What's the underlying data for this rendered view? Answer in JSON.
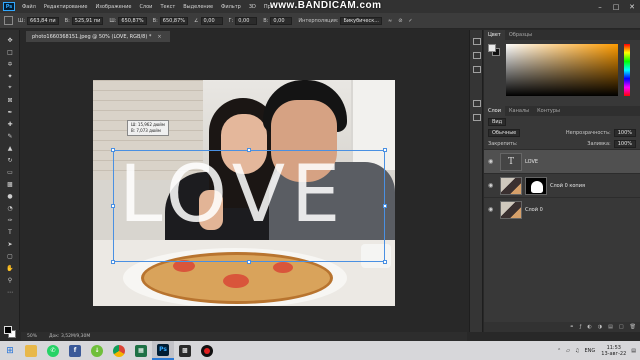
{
  "menubar": {
    "logo": "Ps",
    "items": [
      "Файл",
      "Редактирование",
      "Изображение",
      "Слои",
      "Текст",
      "Выделение",
      "Фильтр",
      "3D",
      "Пр"
    ],
    "watermark": "www.BANDICAM.com"
  },
  "options": {
    "w_label": "Ш:",
    "w_value": "663,84 пи",
    "h_label": "В:",
    "h_value": "525,91 пи",
    "sw_label": "Ш:",
    "sw_value": "650,87%",
    "sh_label": "В:",
    "sh_value": "650,87%",
    "angle_value": "0,00",
    "hskew_label": "Г:",
    "hskew_value": "0,00",
    "vskew_label": "В:",
    "vskew_value": "0,00",
    "interp_label": "Интерполяция:",
    "interp_value": "Бикубическ..."
  },
  "document": {
    "tab_title": "photo1660368151.jpeg @ 50% (LOVE, RGB/8) *",
    "close_glyph": "×",
    "love_text": "LOVE",
    "info_w": "Ш: 15,962 дюйм",
    "info_h": "В: 7,073 дюйм"
  },
  "status": {
    "zoom": "50%",
    "doc": "Док: 3,52M/9,30M"
  },
  "panels": {
    "color_tab": "Цвет",
    "swatches_tab": "Образцы",
    "layers_tab": "Слои",
    "channels_tab": "Каналы",
    "paths_tab": "Контуры",
    "blend_mode": "Обычные",
    "opacity_label": "Непрозрачность:",
    "opacity_value": "100%",
    "lock_label": "Закрепить:",
    "fill_label": "Заливка:",
    "fill_value": "100%",
    "kind_label": "Вид"
  },
  "layers": [
    {
      "name": "LOVE",
      "type": "text",
      "selected": true
    },
    {
      "name": "Слой 0 копия",
      "type": "masked"
    },
    {
      "name": "Слой 0",
      "type": "photo"
    }
  ],
  "taskbar": {
    "apps": [
      "whatsapp",
      "facebook",
      "torrent",
      "chrome",
      "calculator",
      "photoshop",
      "filmstrip",
      "record"
    ],
    "lang": "ENG",
    "time": "11:53",
    "date": "13-авг-22"
  },
  "colors": {
    "accent": "#31a8ff",
    "selection": "#4a90e2"
  }
}
